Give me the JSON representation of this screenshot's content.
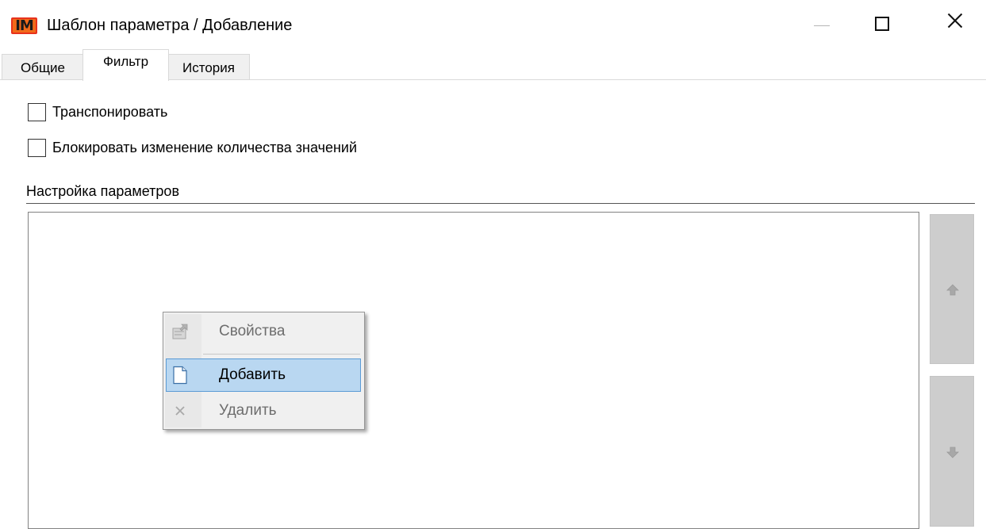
{
  "window": {
    "app_icon_text": "IM",
    "title": "Шаблон параметра / Добавление",
    "controls": {
      "minimize_icon": "minimize-icon",
      "maximize_icon": "maximize-icon",
      "close_icon": "close-icon"
    }
  },
  "tabs": [
    {
      "label": "Общие",
      "selected": false
    },
    {
      "label": "Фильтр",
      "selected": true
    },
    {
      "label": "История",
      "selected": false
    }
  ],
  "options": {
    "transpose": {
      "label": "Транспонировать",
      "checked": false
    },
    "block_count": {
      "label": "Блокировать изменение количества значений",
      "checked": false
    }
  },
  "parameters_section": {
    "title": "Настройка параметров",
    "items": [],
    "move_up_icon": "arrow-up-icon",
    "move_down_icon": "arrow-down-icon"
  },
  "context_menu": {
    "items": [
      {
        "label": "Свойства",
        "icon": "properties-icon",
        "enabled": false,
        "highlighted": false
      },
      {
        "label": "Добавить",
        "icon": "new-document-icon",
        "enabled": true,
        "highlighted": true
      },
      {
        "label": "Удалить",
        "icon": "delete-x-icon",
        "enabled": false,
        "highlighted": false
      }
    ]
  },
  "colors": {
    "menu_highlight": "#b9d7f1",
    "menu_highlight_border": "#5b9bd5",
    "app_icon": "#e8321c",
    "disabled_text": "#6d6d6d",
    "side_button": "#cdcdcd"
  }
}
